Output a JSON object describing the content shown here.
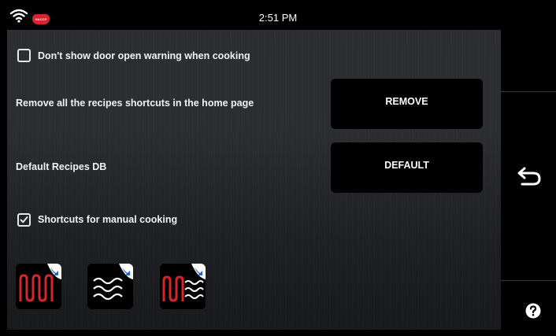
{
  "status_bar": {
    "time": "2:51 PM",
    "wifi_icon": "wifi-icon",
    "badge_icon": "haccp-icon",
    "badge_text": "HACCP"
  },
  "settings": {
    "door_warning": {
      "label": "Don't show door open warning when cooking",
      "checked": false
    },
    "remove_shortcuts": {
      "label": "Remove all the recipes shortcuts in the home page",
      "button_label": "REMOVE"
    },
    "default_db": {
      "label": "Default Recipes DB",
      "button_label": "DEFAULT"
    },
    "manual_shortcuts": {
      "label": "Shortcuts for manual cooking",
      "checked": true
    }
  },
  "shortcuts": [
    {
      "icon": "convection-shortcut-icon"
    },
    {
      "icon": "steam-shortcut-icon"
    },
    {
      "icon": "combi-shortcut-icon"
    }
  ],
  "side_bar": {
    "back_icon": "back-arrow-icon",
    "help_icon": "help-icon"
  },
  "colors": {
    "accent_red": "#d9242b",
    "hand_blue": "#1f63c6",
    "panel": "#2a2c30"
  }
}
